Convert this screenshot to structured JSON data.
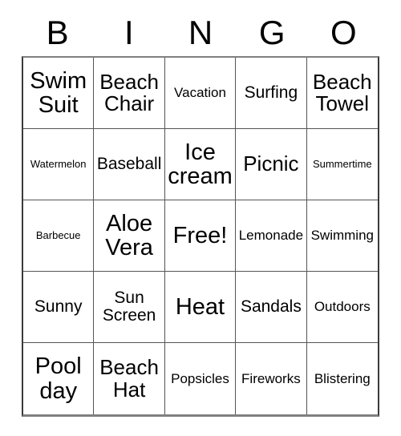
{
  "card": {
    "header_letters": [
      "B",
      "I",
      "N",
      "G",
      "O"
    ],
    "rows": [
      [
        {
          "text": "Swim Suit",
          "size": "xl"
        },
        {
          "text": "Beach Chair",
          "size": "lg"
        },
        {
          "text": "Vacation",
          "size": "sm"
        },
        {
          "text": "Surfing",
          "size": "md"
        },
        {
          "text": "Beach Towel",
          "size": "lg"
        }
      ],
      [
        {
          "text": "Watermelon",
          "size": "xs"
        },
        {
          "text": "Baseball",
          "size": "md"
        },
        {
          "text": "Ice cream",
          "size": "xl"
        },
        {
          "text": "Picnic",
          "size": "lg"
        },
        {
          "text": "Summertime",
          "size": "xs"
        }
      ],
      [
        {
          "text": "Barbecue",
          "size": "xs"
        },
        {
          "text": "Aloe Vera",
          "size": "xl"
        },
        {
          "text": "Free!",
          "size": "xl"
        },
        {
          "text": "Lemonade",
          "size": "sm"
        },
        {
          "text": "Swimming",
          "size": "sm"
        }
      ],
      [
        {
          "text": "Sunny",
          "size": "md"
        },
        {
          "text": "Sun Screen",
          "size": "md"
        },
        {
          "text": "Heat",
          "size": "xl"
        },
        {
          "text": "Sandals",
          "size": "md"
        },
        {
          "text": "Outdoors",
          "size": "sm"
        }
      ],
      [
        {
          "text": "Pool day",
          "size": "xl"
        },
        {
          "text": "Beach Hat",
          "size": "lg"
        },
        {
          "text": "Popsicles",
          "size": "sm"
        },
        {
          "text": "Fireworks",
          "size": "sm"
        },
        {
          "text": "Blistering",
          "size": "sm"
        }
      ]
    ],
    "free_space": {
      "row": 2,
      "col": 2,
      "label": "Free!"
    },
    "colors": {
      "background": "#ffffff",
      "text": "#000000",
      "grid_line": "#555555",
      "outer_border": "#3a3a3a"
    }
  }
}
